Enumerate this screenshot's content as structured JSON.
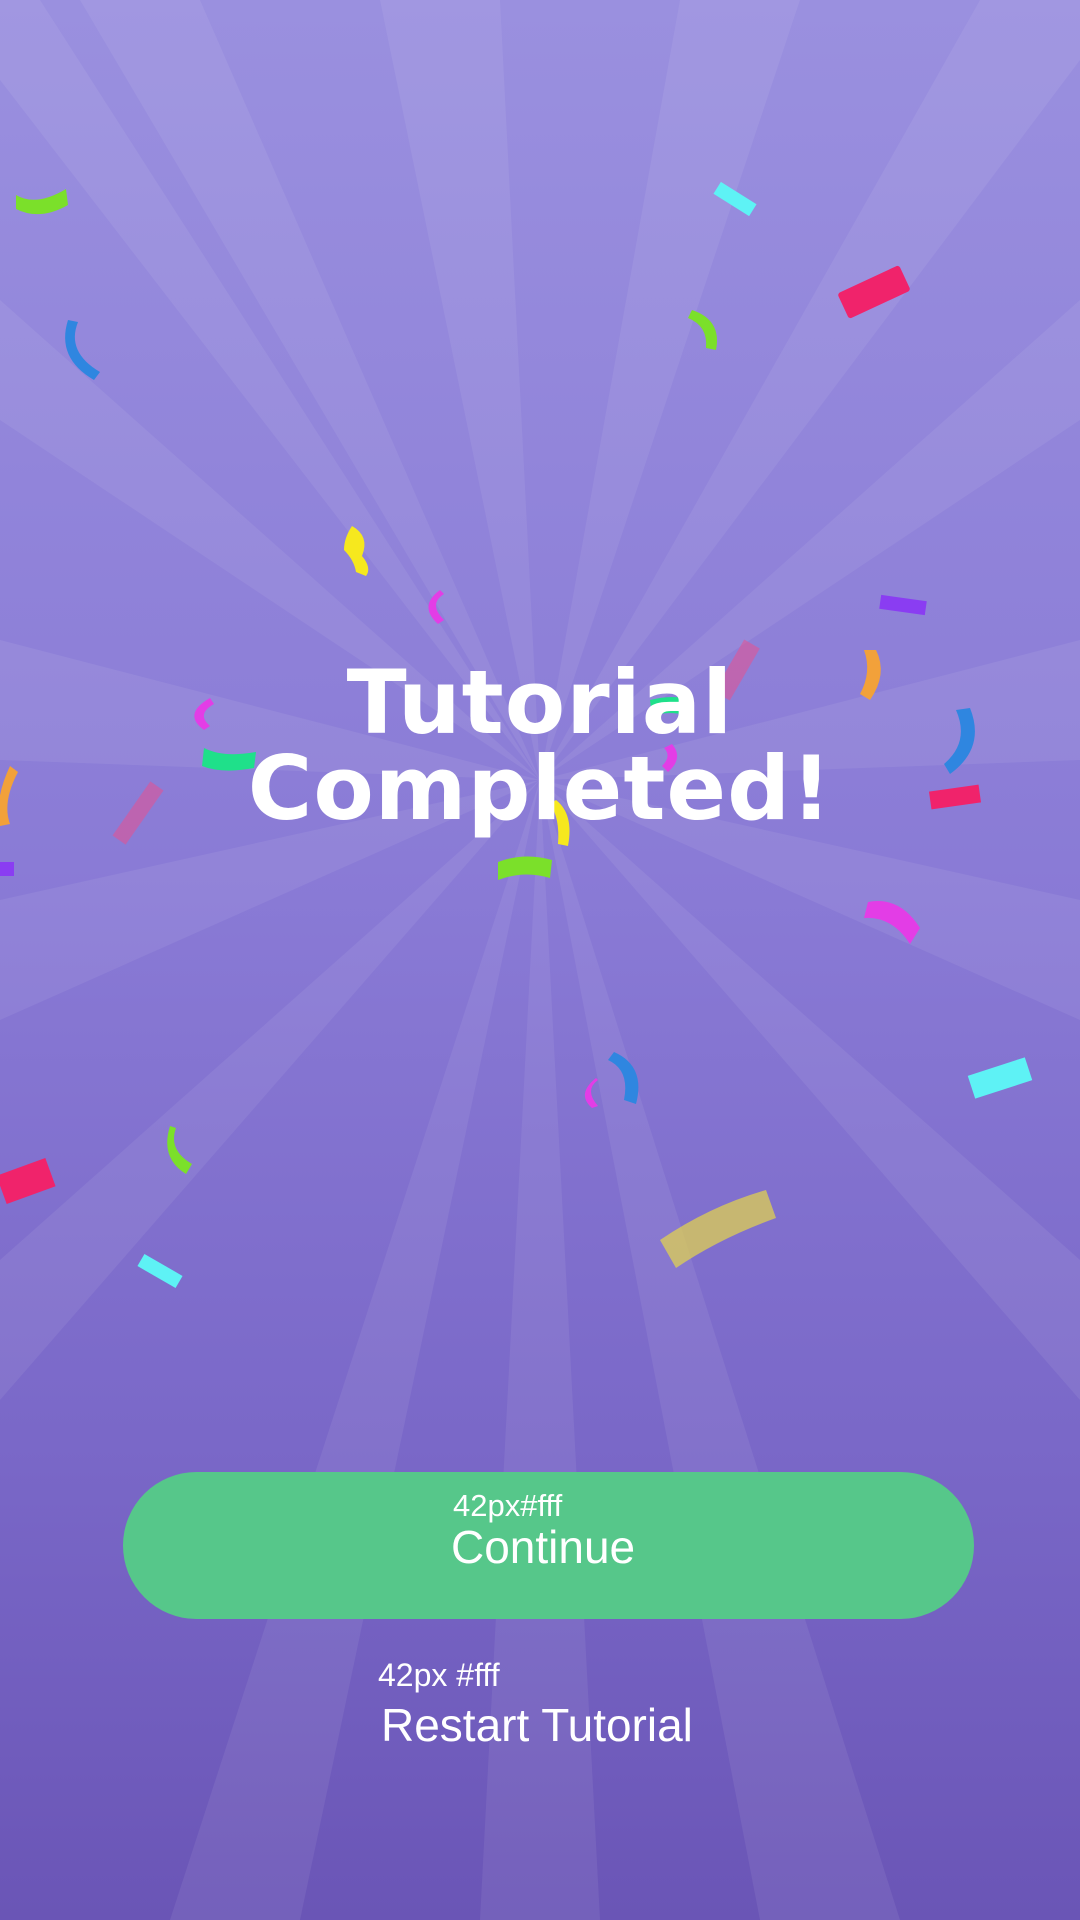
{
  "screen": {
    "title_line1": "Tutorial",
    "title_line2": "Completed!"
  },
  "continue_button": {
    "caption": "42px#fff",
    "label": "Continue"
  },
  "restart_link": {
    "caption": "42px #fff",
    "label": "Restart Tutorial"
  },
  "colors": {
    "background_top": "#9a90df",
    "background_bottom": "#6a55b6",
    "button": "#56c78a",
    "text": "#ffffff"
  },
  "confetti_colors": [
    "#7be02a",
    "#2f86e0",
    "#f0236b",
    "#5ef2f5",
    "#f6e81e",
    "#e33de6",
    "#f2a13a",
    "#1fe08a",
    "#8a3df2"
  ]
}
